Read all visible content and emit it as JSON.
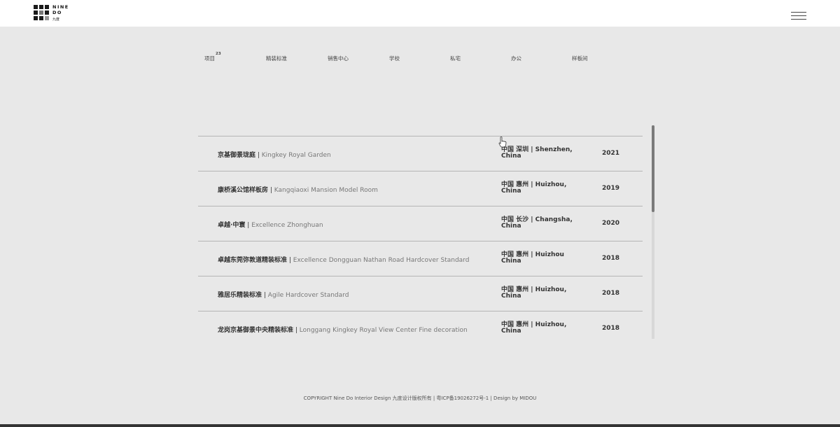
{
  "logo": {
    "line1": "NINE",
    "line2": "DO",
    "sub": "九度"
  },
  "categories": [
    {
      "label": "项目",
      "count": "23"
    },
    {
      "label": "精装标准"
    },
    {
      "label": "销售中心"
    },
    {
      "label": "学校"
    },
    {
      "label": "私宅"
    },
    {
      "label": "办公"
    },
    {
      "label": "样板间"
    }
  ],
  "projects": [
    {
      "name_zh": "京基御景珑庭",
      "name_en": "Kingkey Royal Garden",
      "location": "中国 深圳 | Shenzhen, China",
      "year": "2021"
    },
    {
      "name_zh": "康桥溪公馆样板房",
      "name_en": "Kangqiaoxi Mansion Model Room",
      "location": "中国 惠州 | Huizhou, China",
      "year": "2019"
    },
    {
      "name_zh": "卓越·中寰",
      "name_en": "Excellence Zhonghuan",
      "location": "中国 长沙 | Changsha, China",
      "year": "2020"
    },
    {
      "name_zh": "卓越东莞弥敦道精装标准",
      "name_en": "Excellence Dongguan Nathan Road Hardcover Standard",
      "location": "中国 惠州 | Huizhou China",
      "year": "2018"
    },
    {
      "name_zh": "雅居乐精装标准",
      "name_en": "Agile Hardcover Standard",
      "location": "中国 惠州 | Huizhou, China",
      "year": "2018"
    },
    {
      "name_zh": "龙岗京基御景中央精装标准",
      "name_en": "Longgang Kingkey Royal View Center Fine decoration",
      "location": "中国 惠州 | Huizhou, China",
      "year": "2018"
    }
  ],
  "footer": {
    "text": "COPYRIGHT Nine Do Interior Design 九度设计版权所有 | 粤ICP备19026272号-1 | Design by MIDOU"
  },
  "colors": {
    "background": "#e8e8e8",
    "header": "#ffffff",
    "text": "#333333",
    "muted": "#777777"
  },
  "icons": {
    "menu": "hamburger-menu-icon",
    "logo": "nine-do-logo-grid",
    "cursor": "hand-pointer-icon"
  }
}
